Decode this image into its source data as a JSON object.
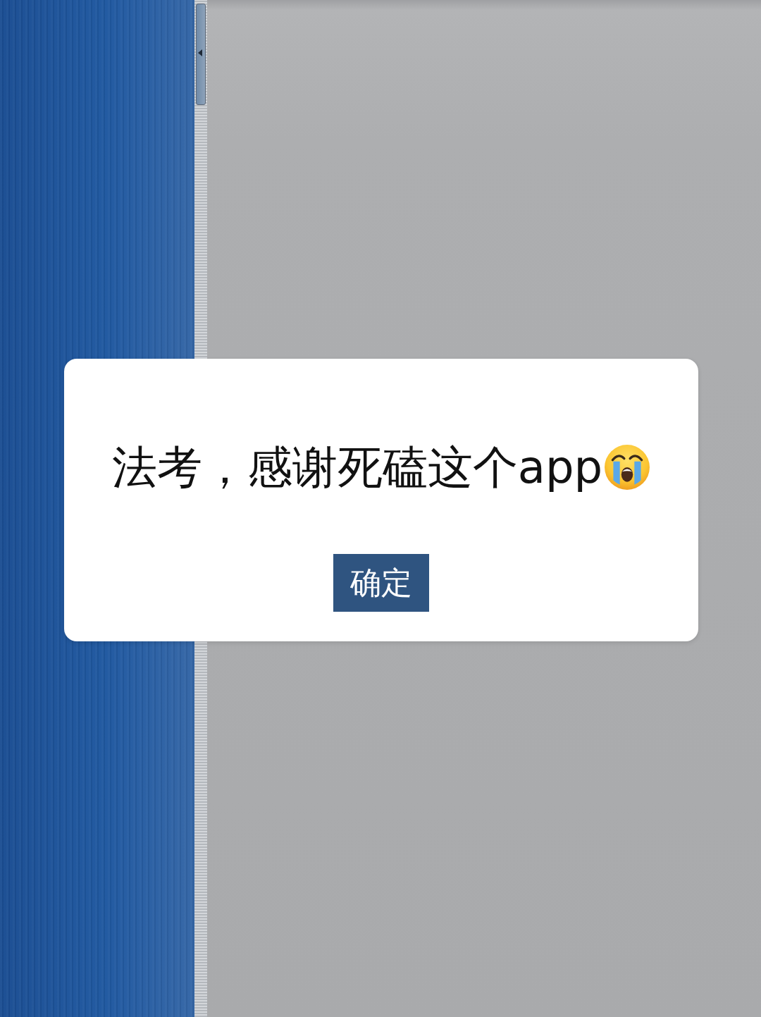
{
  "dialog": {
    "message": "法考，感谢死磕这个app",
    "buttons": [
      {
        "label": "确定",
        "kind": "primary"
      }
    ]
  }
}
